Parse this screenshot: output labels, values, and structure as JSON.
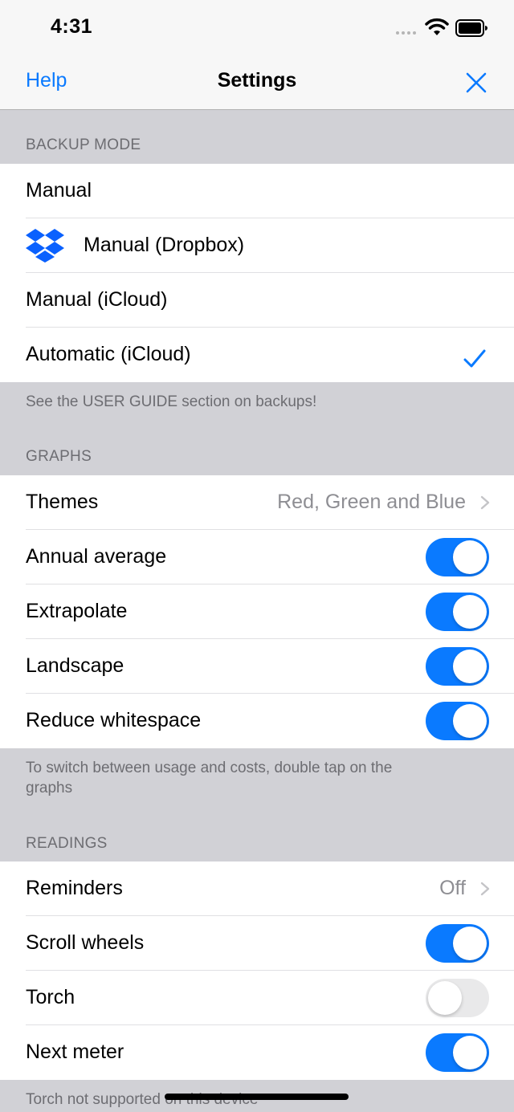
{
  "status_bar": {
    "time": "4:31",
    "wifi_icon": "wifi-icon",
    "battery_icon": "battery-icon"
  },
  "nav": {
    "left_label": "Help",
    "title": "Settings",
    "close_icon": "close-icon",
    "accent_color": "#0a7aff"
  },
  "backup": {
    "header": "BACKUP MODE",
    "items": [
      {
        "label": "Manual"
      },
      {
        "label": "Manual (Dropbox)",
        "icon": "dropbox-icon"
      },
      {
        "label": "Manual (iCloud)"
      },
      {
        "label": "Automatic (iCloud)",
        "selected": true,
        "icon": "checkmark-icon"
      }
    ],
    "footer": "See the USER GUIDE section on backups!"
  },
  "graphs": {
    "header": "GRAPHS",
    "themes_label": "Themes",
    "themes_value": "Red, Green and Blue",
    "toggles": [
      {
        "label": "Annual average",
        "on": true
      },
      {
        "label": "Extrapolate",
        "on": true
      },
      {
        "label": "Landscape",
        "on": true
      },
      {
        "label": "Reduce whitespace",
        "on": true
      }
    ],
    "footer": "To switch between usage and costs, double tap on the graphs"
  },
  "readings": {
    "header": "READINGS",
    "reminders_label": "Reminders",
    "reminders_value": "Off",
    "toggles": [
      {
        "label": "Scroll wheels",
        "on": true
      },
      {
        "label": "Torch",
        "on": false
      },
      {
        "label": "Next meter",
        "on": true
      }
    ],
    "footer": "Torch not supported on this device"
  }
}
